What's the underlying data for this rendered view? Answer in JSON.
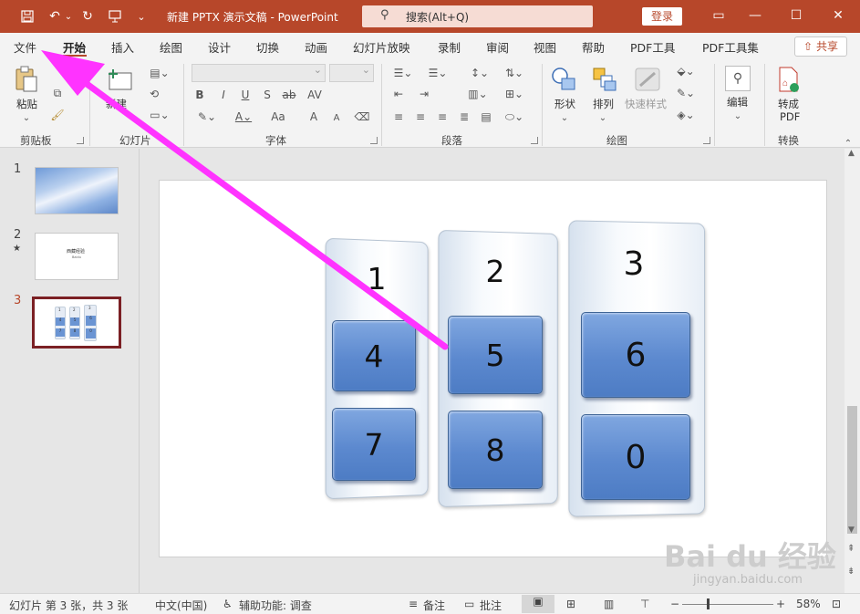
{
  "titlebar": {
    "doc_title": "新建 PPTX 演示文稿  -  PowerPoint",
    "search_placeholder": "搜索(Alt+Q)",
    "login": "登录",
    "icons": [
      "save-icon",
      "undo-icon",
      "redo-icon",
      "present-icon",
      "customize-qat-icon",
      "minimize-icon",
      "maximize-icon",
      "close-icon",
      "ribbon-display-icon"
    ]
  },
  "tabs": [
    "文件",
    "开始",
    "插入",
    "绘图",
    "设计",
    "切换",
    "动画",
    "幻灯片放映",
    "录制",
    "审阅",
    "视图",
    "帮助",
    "PDF工具",
    "PDF工具集"
  ],
  "active_tab": "开始",
  "share": "共享",
  "ribbon": {
    "clipboard": {
      "paste": "粘贴",
      "label": "剪贴板"
    },
    "slides": {
      "new_slide": "新建",
      "slides_label": "幻灯片"
    },
    "font": {
      "label": "字体",
      "bold": "B",
      "italic": "I",
      "underline": "U",
      "shadow": "S",
      "strike": "ab",
      "spacing": "AV",
      "change_case": "Aa",
      "grow": "A",
      "shrink": "A"
    },
    "paragraph": {
      "label": "段落"
    },
    "drawing": {
      "shapes": "形状",
      "arrange": "排列",
      "quick_styles": "快速样式",
      "label": "绘图"
    },
    "editing": {
      "edit": "编辑"
    },
    "convert": {
      "to_pdf_line1": "转成",
      "to_pdf_line2": "PDF",
      "label": "转换"
    }
  },
  "thumbnails": [
    {
      "num": "1",
      "star": ""
    },
    {
      "num": "2",
      "star": "★",
      "text": "西藏经验",
      "sub": "Baidu"
    },
    {
      "num": "3",
      "star": "",
      "selected": true,
      "mini": [
        "1",
        "2",
        "3",
        "4",
        "5",
        "6",
        "7",
        "8",
        "0"
      ]
    }
  ],
  "slide": {
    "columns": [
      {
        "header": "1",
        "keys": [
          "4",
          "7"
        ]
      },
      {
        "header": "2",
        "keys": [
          "5",
          "8"
        ]
      },
      {
        "header": "3",
        "keys": [
          "6",
          "0"
        ]
      }
    ]
  },
  "annotation": {
    "arrow_color": "#ff33ff"
  },
  "watermark": {
    "brand": "Bai du 经验",
    "url": "jingyan.baidu.com"
  },
  "statusbar": {
    "slide_info": "幻灯片 第 3 张，共 3 张",
    "language": "中文(中国)",
    "accessibility": "辅助功能: 调查",
    "notes": "备注",
    "comments": "批注",
    "zoom": "58%"
  },
  "colors": {
    "brand": "#b7472a",
    "key_blue": "#5c89cf",
    "selected_thumb_border": "#7b2024"
  }
}
